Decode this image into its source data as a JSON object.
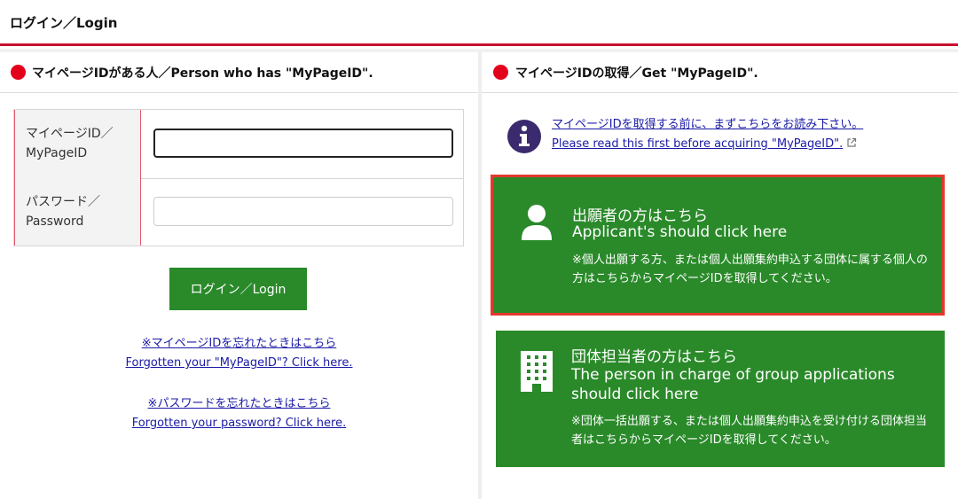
{
  "header": {
    "title": "ログイン／Login"
  },
  "left_panel": {
    "heading": "マイページIDがある人／Person who has \"MyPageID\".",
    "form": {
      "id_label": "マイページID／MyPageID",
      "id_value": "",
      "password_label": "パスワード／Password",
      "password_value": ""
    },
    "login_button": "ログイン／Login",
    "forgot_id": {
      "ja": "※マイページIDを忘れたときはこちら",
      "en": "Forgotten your \"MyPageID\"? Click here."
    },
    "forgot_password": {
      "ja": "※パスワードを忘れたときはこちら",
      "en": "Forgotten your password? Click here."
    }
  },
  "right_panel": {
    "heading": "マイページIDの取得／Get \"MyPageID\".",
    "info_link": {
      "ja": "マイページIDを取得する前に、まずこちらをお読み下さい。",
      "en": "Please read this first before acquiring \"MyPageID\"."
    },
    "applicant_card": {
      "title_ja": "出願者の方はこちら",
      "title_en": "Applicant's should click here",
      "note": "※個人出願する方、または個人出願集約申込する団体に属する個人の方はこちらからマイページIDを取得してください。"
    },
    "group_card": {
      "title_ja": "団体担当者の方はこちら",
      "title_en": "The person in charge of group applications should click here",
      "note": "※団体一括出願する、または個人出願集約申込を受け付ける団体担当者はこちらからマイページIDを取得してください。"
    }
  },
  "icons": {
    "bullet": "red-dot-icon",
    "info": "info-icon",
    "external_link": "external-link-icon",
    "applicant": "person-icon",
    "group": "building-icon"
  },
  "colors": {
    "accent_red": "#e3001b",
    "header_line": "#c8102e",
    "green": "#2a8a2a",
    "card_highlight_border": "#e4392d",
    "link": "#1a1aa6",
    "info_icon_bg": "#3c2a6e"
  }
}
